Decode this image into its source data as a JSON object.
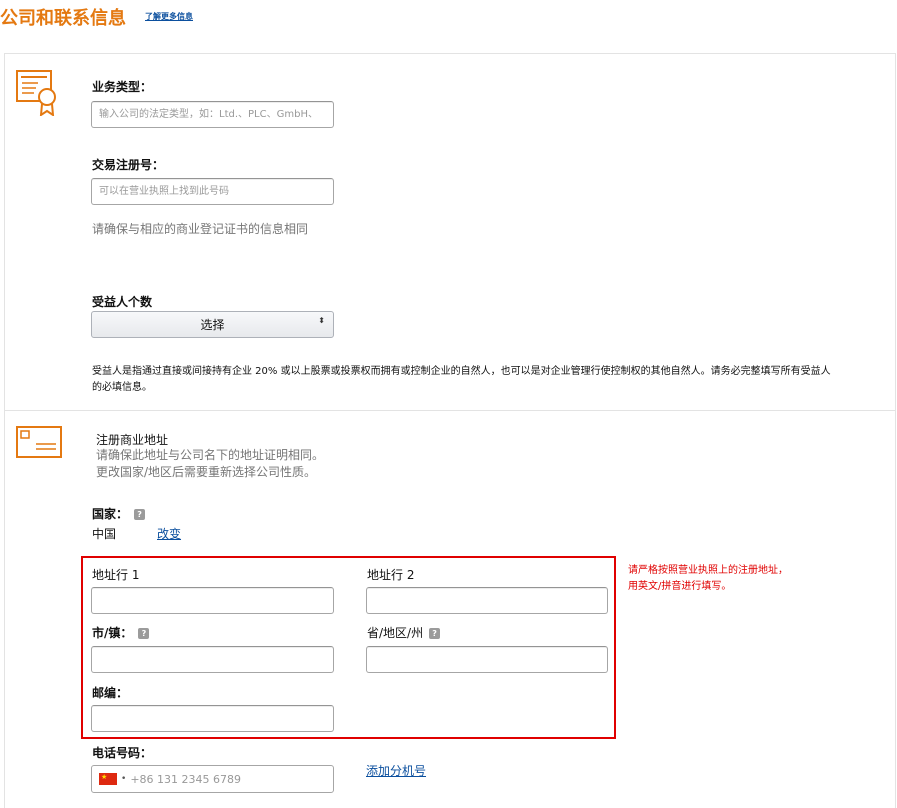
{
  "header": {
    "title": "公司和联系信息",
    "learn_more": "了解更多信息"
  },
  "business": {
    "business_type_label": "业务类型：",
    "business_type_placeholder": "输入公司的法定类型，如：Ltd.、PLC、GmbH、",
    "registration_label": "交易注册号：",
    "registration_placeholder": "可以在营业执照上找到此号码",
    "registration_hint": "请确保与相应的商业登记证书的信息相同",
    "beneficiary_label": "受益人个数",
    "beneficiary_select": "选择",
    "beneficiary_note_line1": "受益人是指通过直接或间接持有企业 20% 或以上股票或投票权而拥有或控制企业的自然人，也可以是对企业管理行使控制权的其他自然人。请务必完整填写所有受益人",
    "beneficiary_note_line2": "的必填信息。"
  },
  "address": {
    "section_title": "注册商业地址",
    "hint_line1": "请确保此地址与公司名下的地址证明相同。",
    "hint_line2": "更改国家/地区后需要重新选择公司性质。",
    "country_label": "国家：",
    "country_value": "中国",
    "change_link": "改变",
    "line1_label": "地址行 1",
    "line2_label": "地址行 2",
    "city_label": "市/镇：",
    "state_label": "省/地区/州",
    "zip_label": "邮编：",
    "phone_label": "电话号码：",
    "phone_placeholder": "+86 131 2345 6789",
    "extension_link": "添加分机号",
    "red_note_line1": "请严格按照营业执照上的注册地址，",
    "red_note_line2": "用英文/拼音进行填写。"
  },
  "icons": {
    "help": "?",
    "certificate": "certificate-icon",
    "address_card": "address-card-icon",
    "select_arrow": "⬍"
  },
  "colors": {
    "accent": "#e47911",
    "link": "#0b4f9e",
    "error": "#e00000"
  }
}
